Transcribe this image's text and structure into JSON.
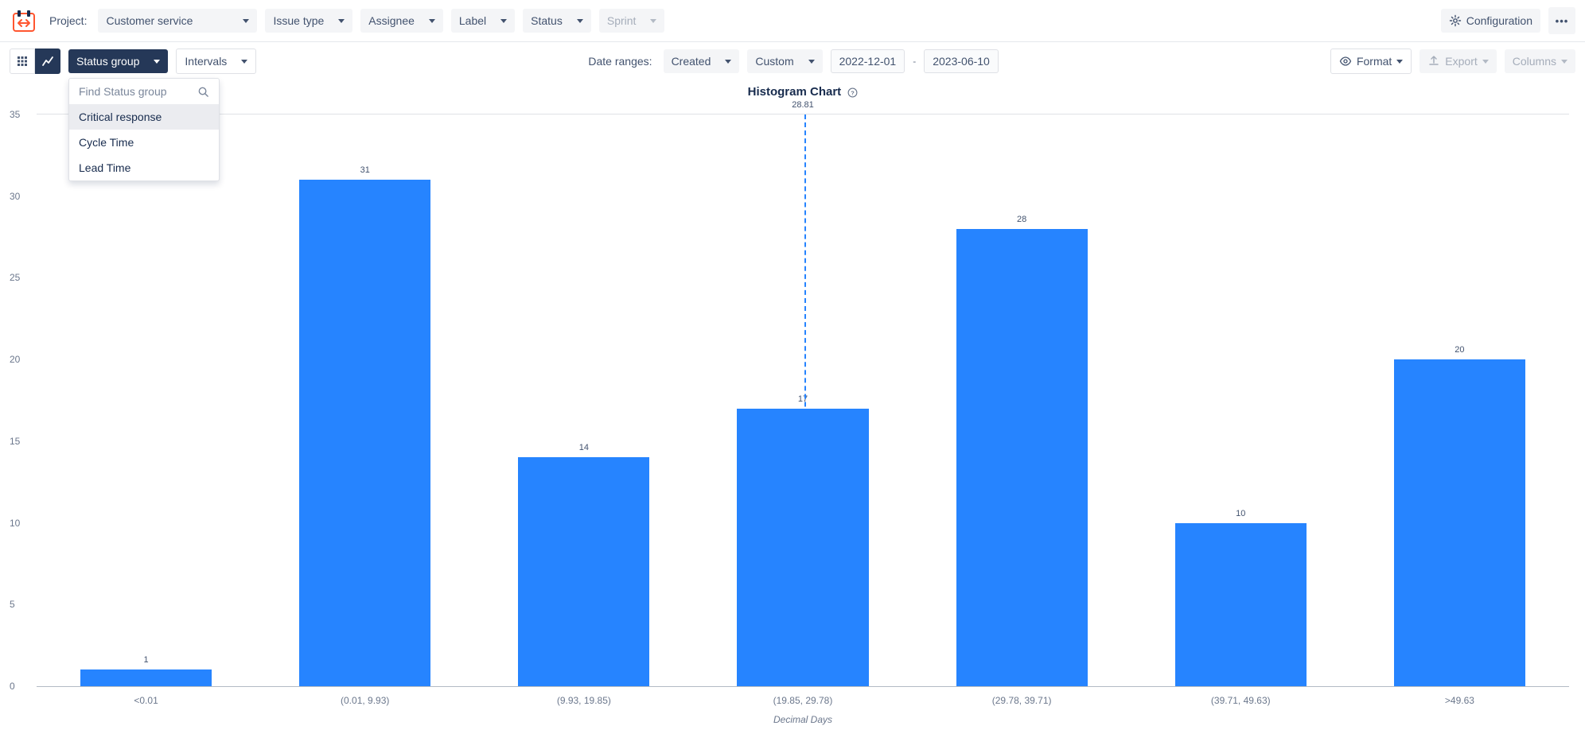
{
  "top": {
    "project_label": "Project:",
    "project_value": "Customer service",
    "issue_type": "Issue type",
    "assignee": "Assignee",
    "label": "Label",
    "status": "Status",
    "sprint": "Sprint",
    "configuration": "Configuration",
    "more": "•••"
  },
  "toolbar": {
    "status_group": "Status group",
    "intervals": "Intervals",
    "date_ranges_label": "Date ranges:",
    "date_range_basis": "Created",
    "date_range_mode": "Custom",
    "date_from": "2022-12-01",
    "date_to": "2023-06-10",
    "format": "Format",
    "export": "Export",
    "columns": "Columns"
  },
  "status_group_menu": {
    "search_placeholder": "Find Status group",
    "items": [
      "Critical response",
      "Cycle Time",
      "Lead Time"
    ]
  },
  "chart_data": {
    "type": "bar",
    "title": "Histogram Chart",
    "mean_label": "28.81",
    "mean_x_fraction": 0.501,
    "xlabel": "Decimal Days",
    "ylabel": "",
    "ylim": [
      0,
      35
    ],
    "yticks": [
      0,
      5,
      10,
      15,
      20,
      25,
      30,
      35
    ],
    "categories": [
      "<0.01",
      "(0.01, 9.93)",
      "(9.93, 19.85)",
      "(19.85, 29.78)",
      "(29.78, 39.71)",
      "(39.71, 49.63)",
      ">49.63"
    ],
    "values": [
      1,
      31,
      14,
      17,
      28,
      10,
      20
    ]
  }
}
